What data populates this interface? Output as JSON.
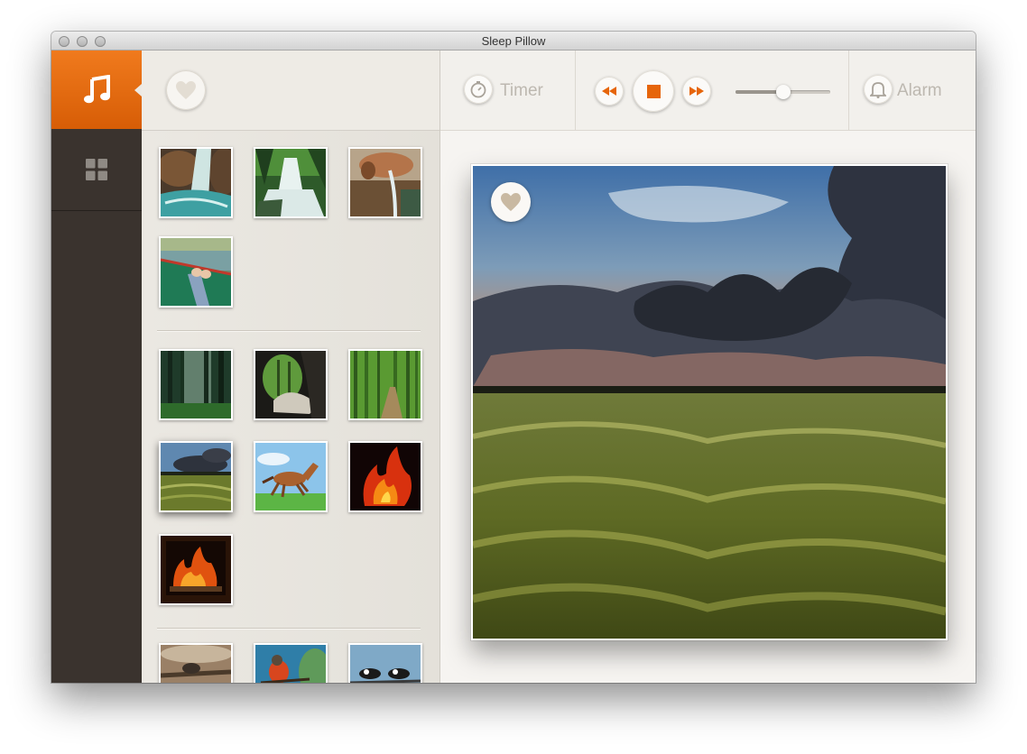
{
  "window": {
    "title": "Sleep Pillow",
    "traffic_lights": [
      "close",
      "minimize",
      "zoom"
    ]
  },
  "sidebar": {
    "items": [
      {
        "icon": "music-note-icon",
        "active": true
      },
      {
        "icon": "grid-icon",
        "active": false
      }
    ],
    "accent_color": "#e66d10",
    "background_color": "#3a332e"
  },
  "gallery": {
    "favorites_icon": "heart-icon",
    "groups": [
      {
        "thumbnails": [
          "stream-rocks",
          "forest-waterfall",
          "water-jug-pour",
          "canoe-lake"
        ]
      },
      {
        "thumbnails": [
          "misty-forest",
          "forest-cave",
          "bamboo-path",
          "wheat-field",
          "running-horse",
          "campfire",
          "fireplace"
        ]
      },
      {
        "thumbnails": [
          "bird-branch",
          "robin",
          "magpies"
        ]
      }
    ],
    "selected": "wheat-field"
  },
  "toolbar": {
    "timer_label": "Timer",
    "alarm_label": "Alarm",
    "controls": [
      "rewind-icon",
      "stop-icon",
      "fast-forward-icon"
    ],
    "volume": 0.5,
    "control_color": "#e6650b"
  },
  "main": {
    "photo": "wheat-field-storm-sky",
    "photo_favorite_icon": "heart-icon"
  }
}
